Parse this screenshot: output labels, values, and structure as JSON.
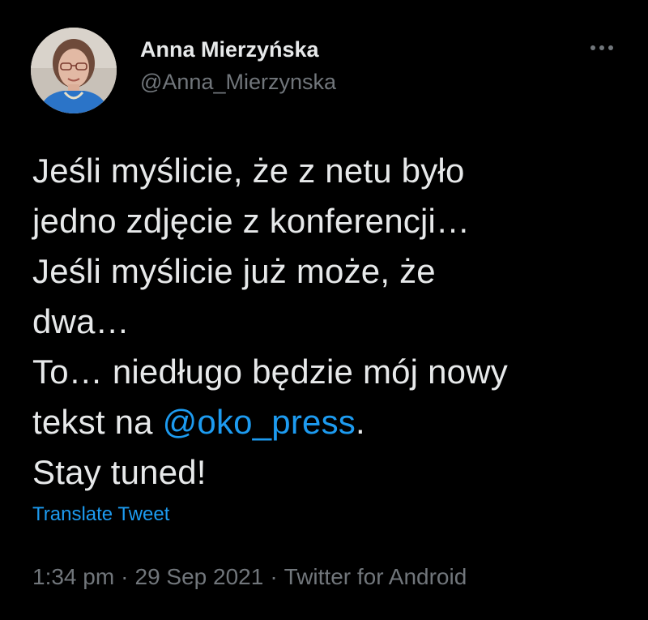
{
  "author": {
    "display_name": "Anna Mierzyńska",
    "handle": "@Anna_Mierzynska",
    "avatar_icon": "profile-photo"
  },
  "menu": {
    "more_icon": "more-horizontal-icon"
  },
  "tweet": {
    "lines": [
      "Jeśli myślicie, że z netu było",
      "jedno zdjęcie z konferencji…",
      "Jeśli myślicie już może, że",
      "dwa…",
      "To… niedługo będzie mój nowy"
    ],
    "line6_prefix": "tekst na ",
    "mention": "@oko_press",
    "line6_suffix": ".",
    "line7": "Stay tuned!"
  },
  "translate_label": "Translate Tweet",
  "meta": {
    "time": "1:34 pm",
    "separator": "·",
    "date": "29 Sep 2021",
    "source": "Twitter for Android"
  },
  "colors": {
    "background": "#000000",
    "text": "#e7e9ea",
    "secondary": "#71767b",
    "accent": "#1d9bf0"
  }
}
